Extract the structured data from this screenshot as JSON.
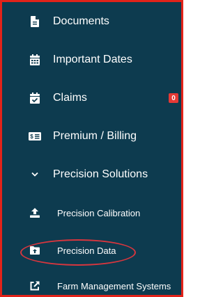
{
  "nav": {
    "items": [
      {
        "label": "Documents",
        "icon": "file-icon"
      },
      {
        "label": "Important Dates",
        "icon": "calendar-icon"
      },
      {
        "label": "Claims",
        "icon": "calendar-check-icon",
        "badge": "0"
      },
      {
        "label": "Premium / Billing",
        "icon": "money-bill-icon"
      },
      {
        "label": "Precision Solutions",
        "icon": "chevron-down-icon",
        "expanded": true
      }
    ],
    "subitems": [
      {
        "label": "Precision Calibration",
        "icon": "upload-icon"
      },
      {
        "label": "Precision Data",
        "icon": "folder-upload-icon",
        "highlighted": true
      },
      {
        "label": "Farm Management Systems",
        "icon": "external-link-icon"
      }
    ]
  },
  "colors": {
    "background": "#0d3b4f",
    "text": "#ffffff",
    "badge": "#e53935",
    "highlight_circle": "#d9363e",
    "border": "#e2231a"
  }
}
